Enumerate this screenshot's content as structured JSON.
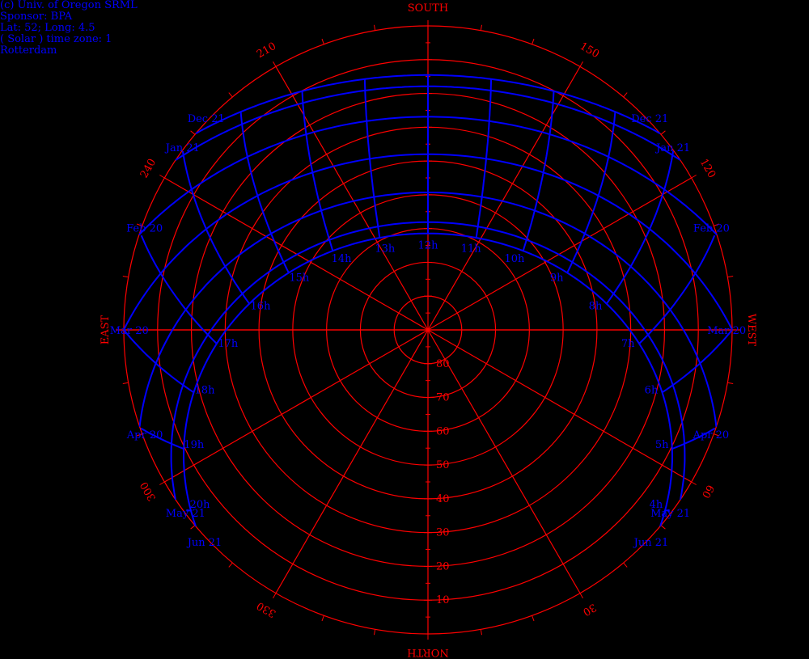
{
  "header": {
    "credit": "(c) Univ. of Oregon SRML",
    "sponsor": "Sponsor: BPA",
    "location": "Lat: 52; Long: 4.5",
    "timezone": "( Solar ) time zone: 1",
    "city": "Rotterdam"
  },
  "chart_data": {
    "type": "polar sun path",
    "compass": {
      "south": "SOUTH",
      "north": "NORTH",
      "east": "EAST",
      "west": "WEST"
    },
    "azimuth_labels": [
      "30",
      "60",
      "120",
      "150",
      "210",
      "240",
      "300",
      "330"
    ],
    "altitude_labels": [
      "10",
      "20",
      "30",
      "40",
      "50",
      "60",
      "70",
      "80"
    ],
    "altitude_range": [
      0,
      90
    ],
    "latitude": 52,
    "dates": [
      {
        "name": "Jun 21",
        "declination": 23.44
      },
      {
        "name": "May 21",
        "declination": 20.1
      },
      {
        "name": "Apr 20",
        "declination": 11.3
      },
      {
        "name": "Mar 20",
        "declination": 0
      },
      {
        "name": "Feb 20",
        "declination": -11.1
      },
      {
        "name": "Jan 21",
        "declination": -20.1
      },
      {
        "name": "Dec 21",
        "declination": -23.44
      }
    ],
    "date_labels": [
      {
        "text": "Dec 21",
        "side": "left"
      },
      {
        "text": "Jan 21",
        "side": "left"
      },
      {
        "text": "Feb 20",
        "side": "left"
      },
      {
        "text": "Mar 20",
        "side": "left"
      },
      {
        "text": "Apr 20",
        "side": "left"
      },
      {
        "text": "May 21",
        "side": "left"
      },
      {
        "text": "Jun 21",
        "side": "left"
      },
      {
        "text": "Dec 21",
        "side": "right"
      },
      {
        "text": "Jan 21",
        "side": "right"
      },
      {
        "text": "Feb 20",
        "side": "right"
      },
      {
        "text": "Mar 20",
        "side": "right"
      },
      {
        "text": "Apr 20",
        "side": "right"
      },
      {
        "text": "May 21",
        "side": "right"
      },
      {
        "text": "Jun 21",
        "side": "right"
      }
    ],
    "hours": [
      4,
      5,
      6,
      7,
      8,
      9,
      10,
      11,
      12,
      13,
      14,
      15,
      16,
      17,
      18,
      19,
      20
    ],
    "hour_labels": [
      "4h",
      "5h",
      "6h",
      "7h",
      "8h",
      "9h",
      "10h",
      "11h",
      "12h",
      "13h",
      "14h",
      "15h",
      "16h",
      "17h",
      "18h",
      "19h",
      "20h"
    ],
    "colors": {
      "grid": "#ff0000",
      "sun_path": "#0000ff",
      "background": "#000000"
    }
  }
}
